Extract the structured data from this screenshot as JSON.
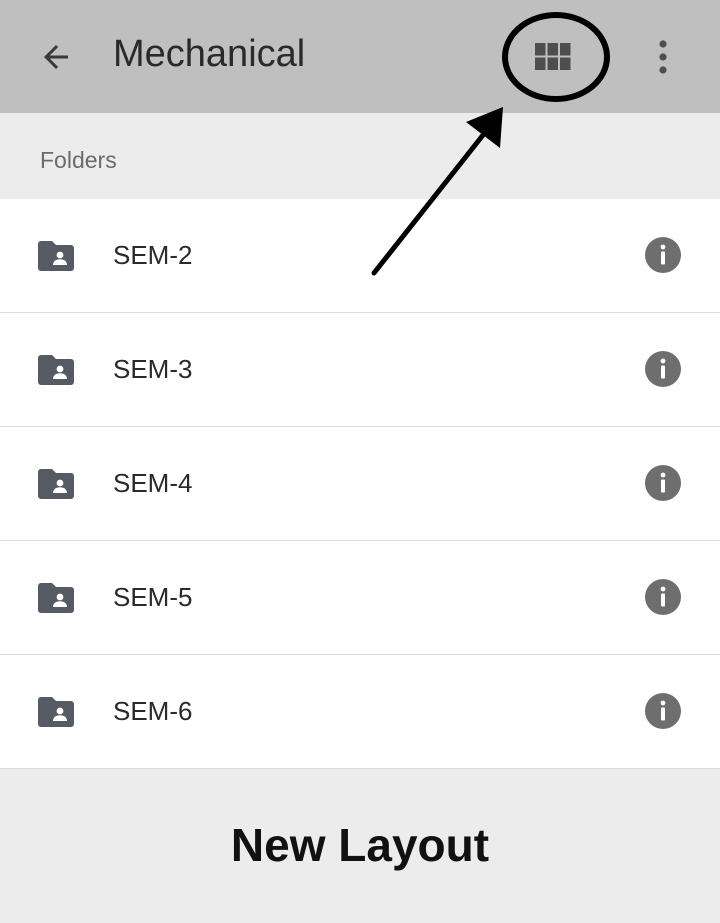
{
  "appbar": {
    "title": "Mechanical",
    "back_icon": "arrow-back-icon",
    "view_toggle_icon": "grid-view-icon",
    "more_icon": "more-vert-icon",
    "background_color": "#bfbfbf"
  },
  "section": {
    "label": "Folders"
  },
  "folders": [
    {
      "name": "SEM-2",
      "icon": "shared-folder-icon",
      "action_icon": "info-icon"
    },
    {
      "name": "SEM-3",
      "icon": "shared-folder-icon",
      "action_icon": "info-icon"
    },
    {
      "name": "SEM-4",
      "icon": "shared-folder-icon",
      "action_icon": "info-icon"
    },
    {
      "name": "SEM-5",
      "icon": "shared-folder-icon",
      "action_icon": "info-icon"
    },
    {
      "name": "SEM-6",
      "icon": "shared-folder-icon",
      "action_icon": "info-icon"
    }
  ],
  "footer": {
    "caption": "New Layout"
  },
  "annotation": {
    "shape": "circle-with-arrow",
    "target": "grid-view-icon",
    "color": "#000000"
  }
}
